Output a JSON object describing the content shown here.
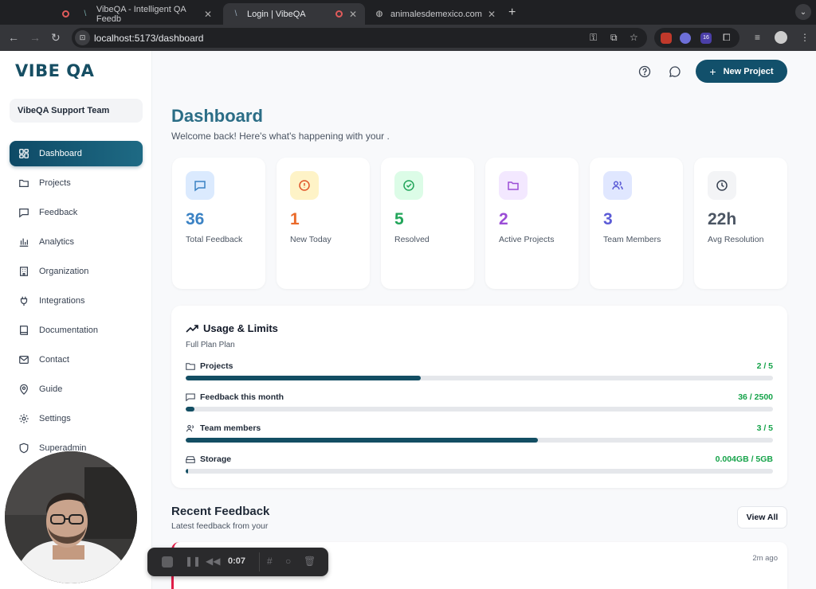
{
  "browser": {
    "tabs": [
      {
        "title": "VibeQA - Intelligent QA Feedb",
        "active": false
      },
      {
        "title": "Login | VibeQA",
        "active": true
      },
      {
        "title": "animalesdemexico.com",
        "active": false
      }
    ],
    "url": "localhost:5173/dashboard",
    "ext_badge": "16"
  },
  "sidebar": {
    "logo": "VIBE QA",
    "team": "VibeQA Support Team",
    "items": [
      {
        "label": "Dashboard",
        "icon": "dashboard-icon"
      },
      {
        "label": "Projects",
        "icon": "folder-icon"
      },
      {
        "label": "Feedback",
        "icon": "message-icon"
      },
      {
        "label": "Analytics",
        "icon": "bar-chart-icon"
      },
      {
        "label": "Organization",
        "icon": "building-icon"
      },
      {
        "label": "Integrations",
        "icon": "plug-icon"
      },
      {
        "label": "Documentation",
        "icon": "book-icon"
      },
      {
        "label": "Contact",
        "icon": "mail-icon"
      },
      {
        "label": "Guide",
        "icon": "map-pin-icon"
      },
      {
        "label": "Settings",
        "icon": "gear-icon"
      },
      {
        "label": "Superadmin",
        "icon": "shield-icon"
      }
    ]
  },
  "header": {
    "new_project": "New Project"
  },
  "main": {
    "title": "Dashboard",
    "subtitle": "Welcome back! Here's what's happening with your .",
    "stats": [
      {
        "value": "36",
        "label": "Total Feedback",
        "color": "#3b82c4",
        "bg": "#dbeafe"
      },
      {
        "value": "1",
        "label": "New Today",
        "color": "#ea6a2a",
        "bg": "#fef3c7"
      },
      {
        "value": "5",
        "label": "Resolved",
        "color": "#22a55a",
        "bg": "#dcfce7"
      },
      {
        "value": "2",
        "label": "Active Projects",
        "color": "#9b4dd6",
        "bg": "#f3e8ff"
      },
      {
        "value": "3",
        "label": "Team Members",
        "color": "#5b5bd6",
        "bg": "#e0e7ff"
      },
      {
        "value": "22h",
        "label": "Avg Resolution",
        "color": "#4b5563",
        "bg": "#f3f4f6"
      }
    ],
    "usage": {
      "title": "Usage & Limits",
      "plan": "Full Plan Plan",
      "rows": [
        {
          "label": "Projects",
          "value": "2 / 5",
          "fraction": 0.4
        },
        {
          "label": "Feedback this month",
          "value": "36 / 2500",
          "fraction": 0.0144
        },
        {
          "label": "Team members",
          "value": "3 / 5",
          "fraction": 0.6
        },
        {
          "label": "Storage",
          "value": "0.004GB / 5GB",
          "fraction": 0.0008
        }
      ]
    },
    "recent": {
      "title": "Recent Feedback",
      "subtitle": "Latest feedback from your",
      "view_all": "View All",
      "first_time": "2m ago"
    }
  },
  "recorder": {
    "time": "0:07"
  }
}
